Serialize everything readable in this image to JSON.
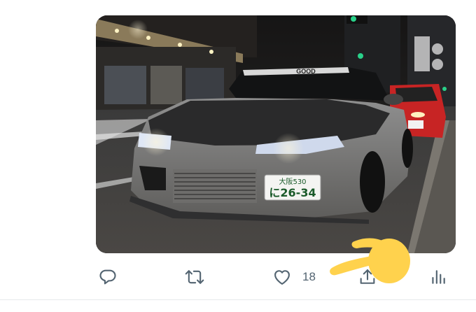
{
  "post": {
    "image": {
      "plate_top": "大阪530",
      "plate_bottom": "に26-34",
      "banner_text": "GOOD"
    }
  },
  "actions": {
    "reply": {
      "icon": "reply-icon"
    },
    "retweet": {
      "icon": "retweet-icon"
    },
    "like": {
      "icon": "heart-icon",
      "count": "18"
    },
    "share": {
      "icon": "share-icon"
    },
    "analytics": {
      "icon": "analytics-icon"
    }
  },
  "colors": {
    "icon": "#536471",
    "divider": "#e6e9eb",
    "pointer": "#ffd24d"
  }
}
